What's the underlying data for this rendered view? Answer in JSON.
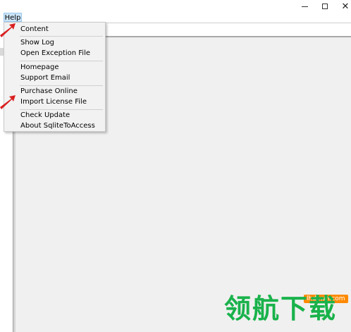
{
  "window": {
    "minimize_icon": "minimize-icon",
    "maximize_icon": "maximize-icon",
    "close_icon": "close-icon"
  },
  "menubar": {
    "help_label": "Help"
  },
  "help_menu": {
    "items": [
      {
        "label": "Content"
      },
      {
        "label": "Show Log"
      },
      {
        "label": "Open Exception File"
      },
      {
        "label": "Homepage"
      },
      {
        "label": "Support Email"
      },
      {
        "label": "Purchase Online"
      },
      {
        "label": "Import License File"
      },
      {
        "label": "Check Update"
      },
      {
        "label": "About SqliteToAccess"
      }
    ]
  },
  "watermark": {
    "url": "lhdown.com",
    "text": "领航下载"
  },
  "colors": {
    "menu_highlight": "#cce4f7",
    "arrow": "#d92020",
    "watermark_green": "#19b24b",
    "watermark_orange": "#ff8a00"
  }
}
